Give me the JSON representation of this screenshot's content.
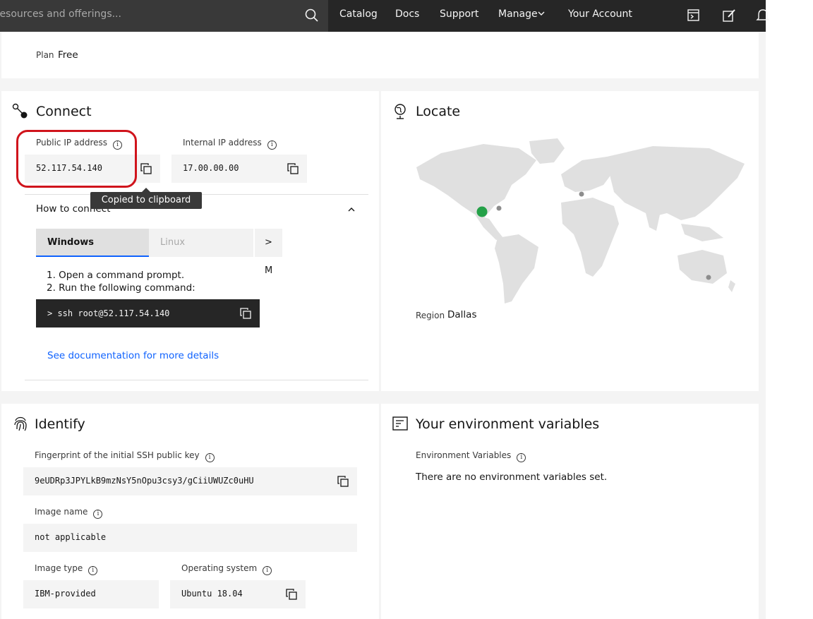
{
  "header": {
    "search_placeholder": "resources and offerings...",
    "nav": [
      "Catalog",
      "Docs",
      "Support",
      "Manage",
      "Your Account"
    ]
  },
  "plan": {
    "label": "Plan",
    "value": "Free"
  },
  "connect": {
    "title": "Connect",
    "public_ip_label": "Public IP address",
    "public_ip": "52.117.54.140",
    "internal_ip_label": "Internal IP address",
    "internal_ip": "17.00.00.00",
    "tooltip": "Copied to clipboard",
    "how_to_connect": "How to connect",
    "tabs": [
      "Windows",
      "Linux",
      "> M"
    ],
    "steps": [
      "1.   Open a command prompt.",
      "2.   Run the following command:"
    ],
    "command": "> ssh root@52.117.54.140",
    "doc_link": "See documentation for more details"
  },
  "locate": {
    "title": "Locate",
    "region_label": "Region",
    "region": "Dallas"
  },
  "identify": {
    "title": "Identify",
    "fingerprint_label": "Fingerprint of the initial SSH public key",
    "fingerprint": "9eUDRp3JPYLkB9mzNsY5nOpu3csy3/gCiiUWUZc0uHU",
    "image_name_label": "Image name",
    "image_name": "not applicable",
    "image_type_label": "Image type",
    "image_type": "IBM-provided",
    "os_label": "Operating system",
    "os": "Ubuntu 18.04"
  },
  "env": {
    "title": "Your environment variables",
    "label": "Environment Variables",
    "empty": "There are no environment variables set."
  },
  "colors": {
    "accent": "#0f62fe",
    "highlight": "#d0141c",
    "location_dot": "#24a148"
  }
}
